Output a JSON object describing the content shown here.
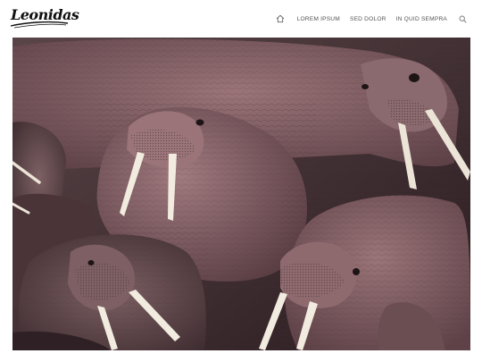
{
  "header": {
    "logo_text": "Leonidas",
    "nav": [
      {
        "label": "LOREM IPSUM"
      },
      {
        "label": "SED DOLOR"
      },
      {
        "label": "IN QUID SEMPRA"
      }
    ],
    "icons": {
      "home": "home-icon",
      "search": "search-icon"
    }
  },
  "hero": {
    "subject": "walrus-herd-photo"
  }
}
